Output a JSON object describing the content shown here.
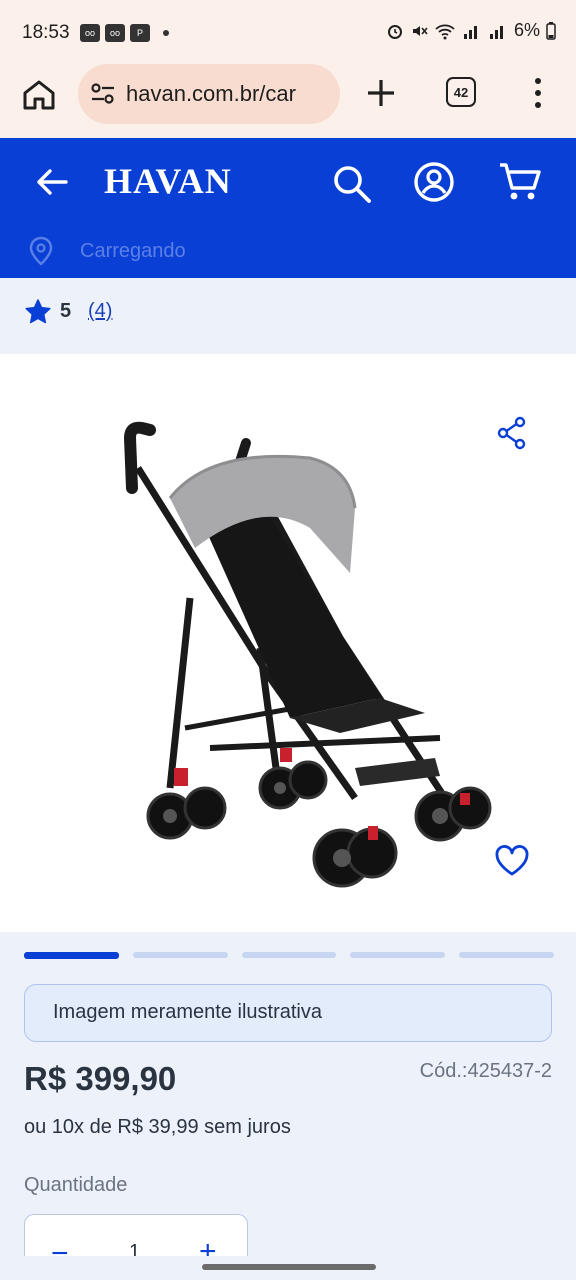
{
  "status_bar": {
    "time": "18:53",
    "battery": "6%",
    "notifications": [
      "voicemail-icon",
      "voicemail-icon",
      "parking-icon"
    ]
  },
  "browser": {
    "url": "havan.com.br/car",
    "tab_count": "42"
  },
  "header": {
    "logo": "HAVAN",
    "location": "Carregando",
    "colors": {
      "brand": "#0a3fd6",
      "brand_light": "#5a80e6"
    }
  },
  "rating": {
    "value": "5",
    "count": "(4)"
  },
  "carousel": {
    "total": 5,
    "active_index": 0
  },
  "product": {
    "disclaimer": "Imagem meramente ilustrativa",
    "price": "R$ 399,90",
    "code": "Cód.:425437-2",
    "installments": "ou 10x de R$ 39,99 sem juros",
    "quantity_label": "Quantidade",
    "quantity": "1",
    "minus_label": "−",
    "plus_label": "+"
  }
}
